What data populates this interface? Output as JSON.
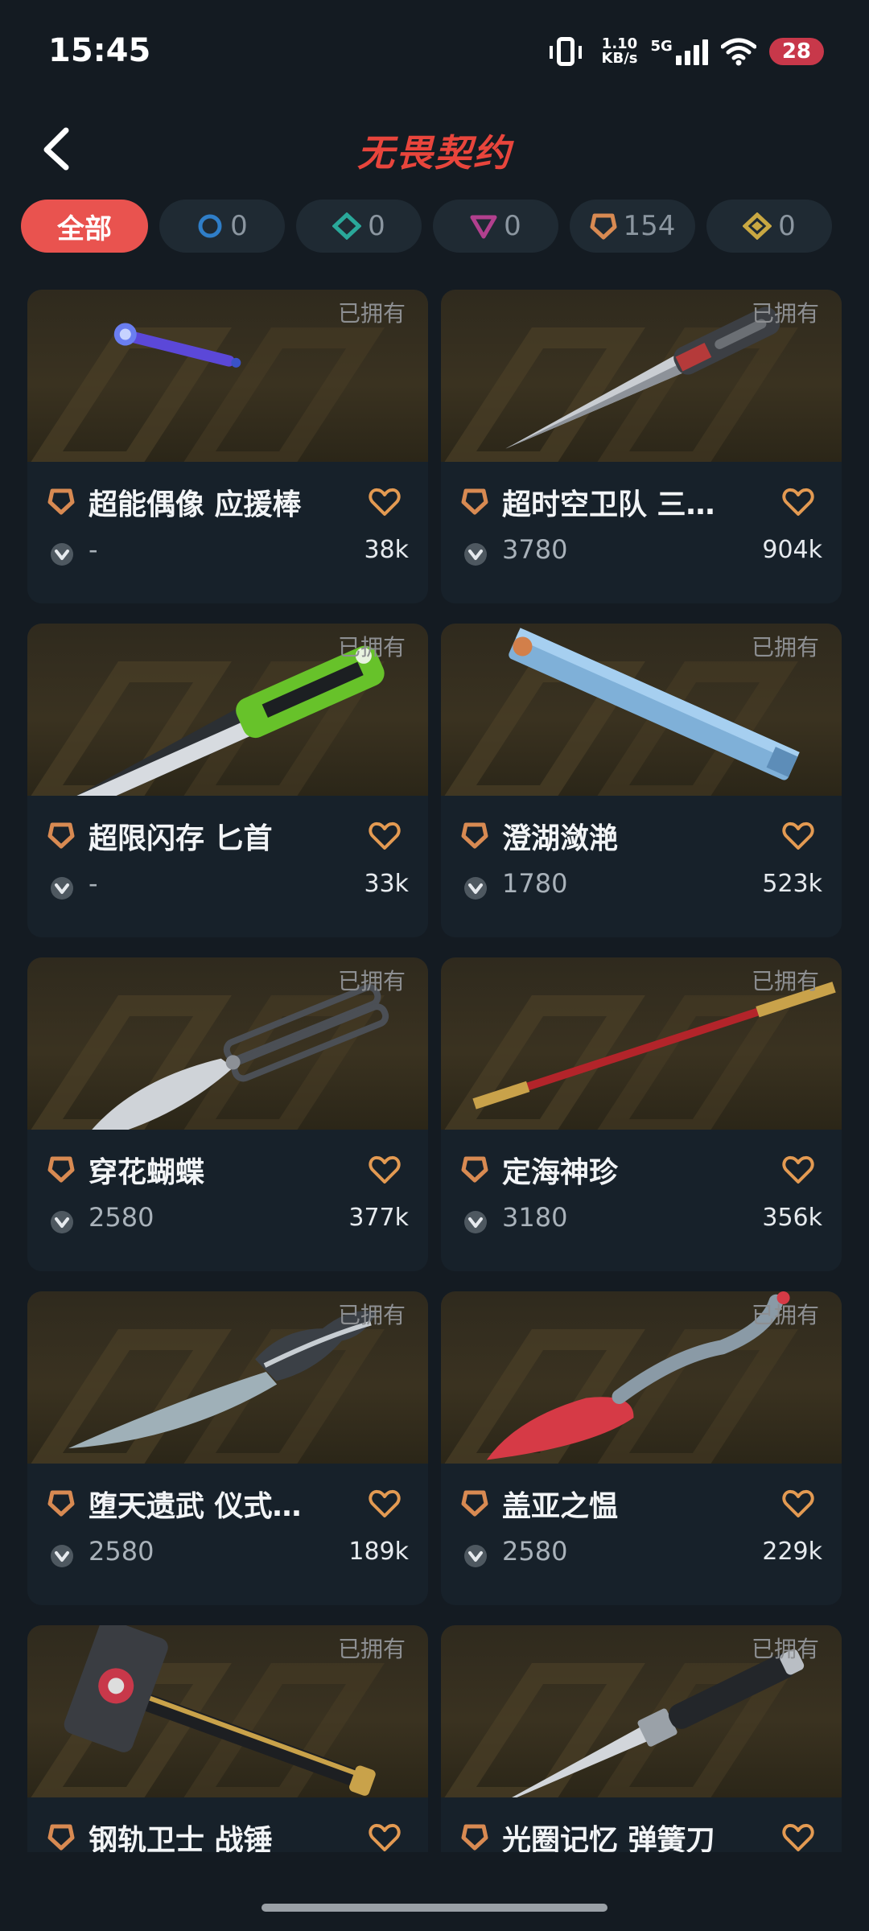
{
  "status": {
    "time": "15:45",
    "net_speed_value": "1.10",
    "net_speed_unit": "KB/s",
    "network": "5G",
    "battery": "28"
  },
  "header": {
    "title": "无畏契约",
    "back_icon": "back-chevron-icon"
  },
  "filters": [
    {
      "label": "全部",
      "active": true
    },
    {
      "icon": "select-tier-icon",
      "count": "0",
      "color": "#2f7ec8"
    },
    {
      "icon": "deluxe-tier-icon",
      "count": "0",
      "color": "#2aa89a"
    },
    {
      "icon": "premium-tier-icon",
      "count": "0",
      "color": "#b2408e"
    },
    {
      "icon": "exclusive-tier-icon",
      "count": "154",
      "color": "#d88a52"
    },
    {
      "icon": "ultra-tier-icon",
      "count": "0",
      "color": "#c9a842"
    }
  ],
  "cards": [
    {
      "owned_label": "已拥有",
      "name": "超能偶像 应援棒",
      "price": "-",
      "likes": "38k",
      "weapon": "baton"
    },
    {
      "owned_label": "已拥有",
      "name": "超时空卫队 三…",
      "price": "3780",
      "likes": "904k",
      "weapon": "dagger"
    },
    {
      "owned_label": "已拥有",
      "name": "超限闪存 匕首",
      "price": "-",
      "likes": "33k",
      "weapon": "tanto"
    },
    {
      "owned_label": "已拥有",
      "name": "澄湖潋滟",
      "price": "1780",
      "likes": "523k",
      "weapon": "fan"
    },
    {
      "owned_label": "已拥有",
      "name": "穿花蝴蝶",
      "price": "2580",
      "likes": "377k",
      "weapon": "butterfly"
    },
    {
      "owned_label": "已拥有",
      "name": "定海神珍",
      "price": "3180",
      "likes": "356k",
      "weapon": "staff"
    },
    {
      "owned_label": "已拥有",
      "name": "堕天遗武 仪式…",
      "price": "2580",
      "likes": "189k",
      "weapon": "curved"
    },
    {
      "owned_label": "已拥有",
      "name": "盖亚之愠",
      "price": "2580",
      "likes": "229k",
      "weapon": "vine"
    },
    {
      "owned_label": "已拥有",
      "name": "钢轨卫士 战锤",
      "price": "",
      "likes": "",
      "weapon": "hammer"
    },
    {
      "owned_label": "已拥有",
      "name": "光圈记忆 弹簧刀",
      "price": "",
      "likes": "",
      "weapon": "switchblade"
    }
  ],
  "colors": {
    "accent": "#e9534f",
    "tier_exclusive": "#d88a52",
    "heart": "#e39a52",
    "background": "#141b22"
  }
}
